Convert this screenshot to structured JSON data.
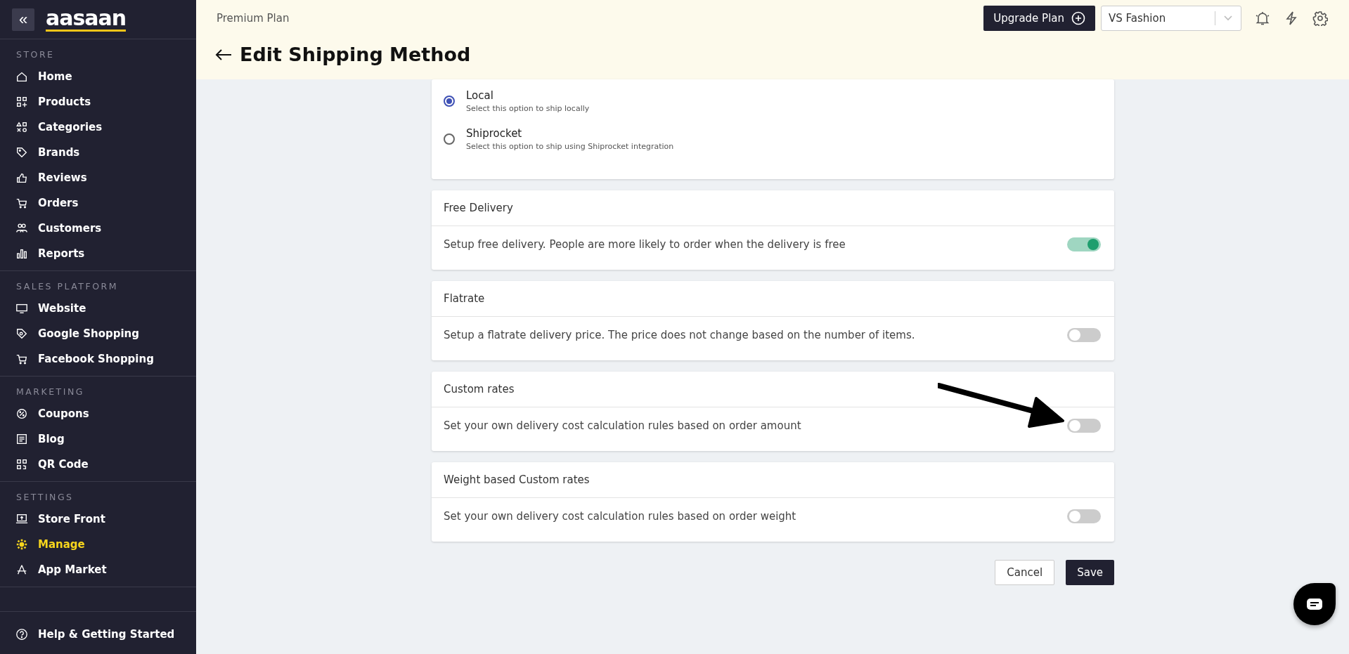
{
  "sidebar": {
    "logo": "aasaan",
    "collapse_icon": "«",
    "sections": [
      {
        "title": "STORE",
        "items": [
          {
            "label": "Home",
            "selected": false
          },
          {
            "label": "Products",
            "selected": false
          },
          {
            "label": "Categories",
            "selected": false
          },
          {
            "label": "Brands",
            "selected": false
          },
          {
            "label": "Reviews",
            "selected": false
          },
          {
            "label": "Orders",
            "selected": false
          },
          {
            "label": "Customers",
            "selected": false
          },
          {
            "label": "Reports",
            "selected": false
          }
        ]
      },
      {
        "title": "SALES PLATFORM",
        "items": [
          {
            "label": "Website",
            "selected": false
          },
          {
            "label": "Google Shopping",
            "selected": false
          },
          {
            "label": "Facebook Shopping",
            "selected": false
          }
        ]
      },
      {
        "title": "MARKETING",
        "items": [
          {
            "label": "Coupons",
            "selected": false
          },
          {
            "label": "Blog",
            "selected": false
          },
          {
            "label": "QR Code",
            "selected": false
          }
        ]
      },
      {
        "title": "SETTINGS",
        "items": [
          {
            "label": "Store Front",
            "selected": false
          },
          {
            "label": "Manage",
            "selected": true
          },
          {
            "label": "App Market",
            "selected": false
          }
        ]
      }
    ],
    "help": "Help & Getting Started"
  },
  "header": {
    "plan": "Premium Plan",
    "upgrade_button": "Upgrade Plan",
    "store_select": "VS Fashion",
    "title": "Edit Shipping Method"
  },
  "shipping_options": [
    {
      "label": "Local",
      "description": "Select this option to ship locally",
      "selected": true
    },
    {
      "label": "Shiprocket",
      "description": "Select this option to ship using Shiprocket integration",
      "selected": false
    }
  ],
  "delivery_cards": [
    {
      "title": "Free Delivery",
      "description": "Setup free delivery. People are more likely to order when the delivery is free",
      "on": true
    },
    {
      "title": "Flatrate",
      "description": "Setup a flatrate delivery price. The price does not change based on the number of items.",
      "on": false
    },
    {
      "title": "Custom rates",
      "description": "Set your own delivery cost calculation rules based on order amount",
      "on": false
    },
    {
      "title": "Weight based Custom rates",
      "description": "Set your own delivery cost calculation rules based on order weight",
      "on": false
    }
  ],
  "buttons": {
    "cancel": "Cancel",
    "save": "Save"
  }
}
